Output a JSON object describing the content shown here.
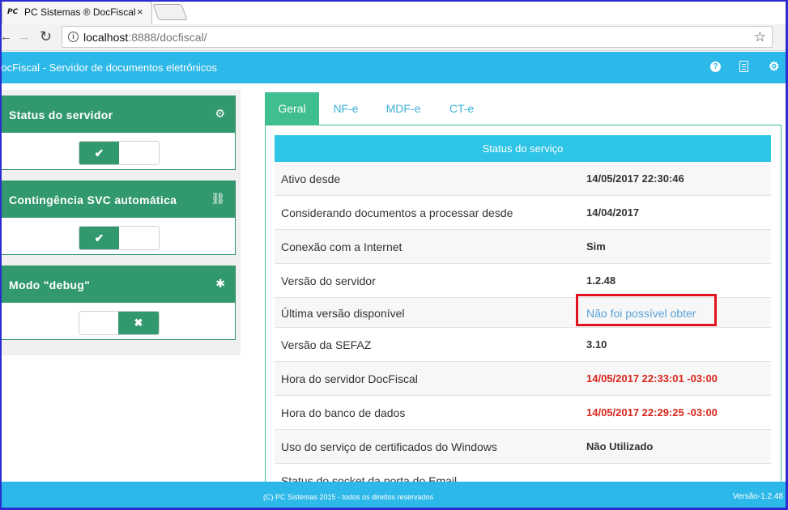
{
  "browser": {
    "tab_title": "PC Sistemas ® DocFiscal",
    "favicon_text": "PC",
    "tab_close": "×",
    "url_host": "localhost",
    "url_rest": ":8888/docfiscal/",
    "star": "☆"
  },
  "app": {
    "title": "DocFiscal - Servidor de documentos eletrônicos",
    "header_icons": [
      "help-icon",
      "document-icon",
      "gear-icon"
    ],
    "help_glyph": "?",
    "gear_glyph": "⚙"
  },
  "panels": [
    {
      "title": "Status do servidor",
      "icon": "cogs-icon",
      "icon_glyph": "⚙",
      "state": "on",
      "on_glyph": "✔",
      "off_glyph": ""
    },
    {
      "title": "Contingência SVC automática",
      "icon": "chain-icon",
      "icon_glyph": "⛓",
      "state": "on",
      "on_glyph": "✔",
      "off_glyph": ""
    },
    {
      "title": "Modo \"debug\"",
      "icon": "bug-icon",
      "icon_glyph": "✱",
      "state": "off",
      "on_glyph": "",
      "off_glyph": "✖"
    }
  ],
  "tabs": [
    {
      "label": "Geral",
      "active": true
    },
    {
      "label": "NF-e",
      "active": false
    },
    {
      "label": "MDF-e",
      "active": false
    },
    {
      "label": "CT-e",
      "active": false
    }
  ],
  "status": {
    "heading": "Status do serviço",
    "rows": [
      {
        "label": "Ativo desde",
        "value": "14/05/2017 22:30:46",
        "style": "normal"
      },
      {
        "label": "Considerando documentos a processar desde",
        "value": "14/04/2017",
        "style": "normal"
      },
      {
        "label": "Conexão com a Internet",
        "value": "Sim",
        "style": "normal"
      },
      {
        "label": "Versão do servidor",
        "value": "1.2.48",
        "style": "normal"
      },
      {
        "label": "Última versão disponível",
        "value": "Não foi possível obter",
        "style": "link"
      },
      {
        "label": "Versão da SEFAZ",
        "value": "3.10",
        "style": "normal"
      },
      {
        "label": "Hora do servidor DocFiscal",
        "value": "14/05/2017 22:33:01 -03:00",
        "style": "red"
      },
      {
        "label": "Hora do banco de dados",
        "value": "14/05/2017 22:29:25 -03:00",
        "style": "red"
      },
      {
        "label": "Uso do serviço de certificados do Windows",
        "value": "Não Utilizado",
        "style": "normal"
      },
      {
        "label": "Status do socket da porta do Email",
        "value": "",
        "style": "normal"
      }
    ]
  },
  "footer": {
    "copyright": "(C) PC Sistemas 2015 - todos os direitos reservados",
    "version": "Versão-1.2.48"
  },
  "colors": {
    "header_blue": "#2cb8e8",
    "panel_green": "#32996e",
    "tab_green": "#3fbe8f",
    "error_red": "#d9261c",
    "highlight_red": "#e0141c"
  }
}
